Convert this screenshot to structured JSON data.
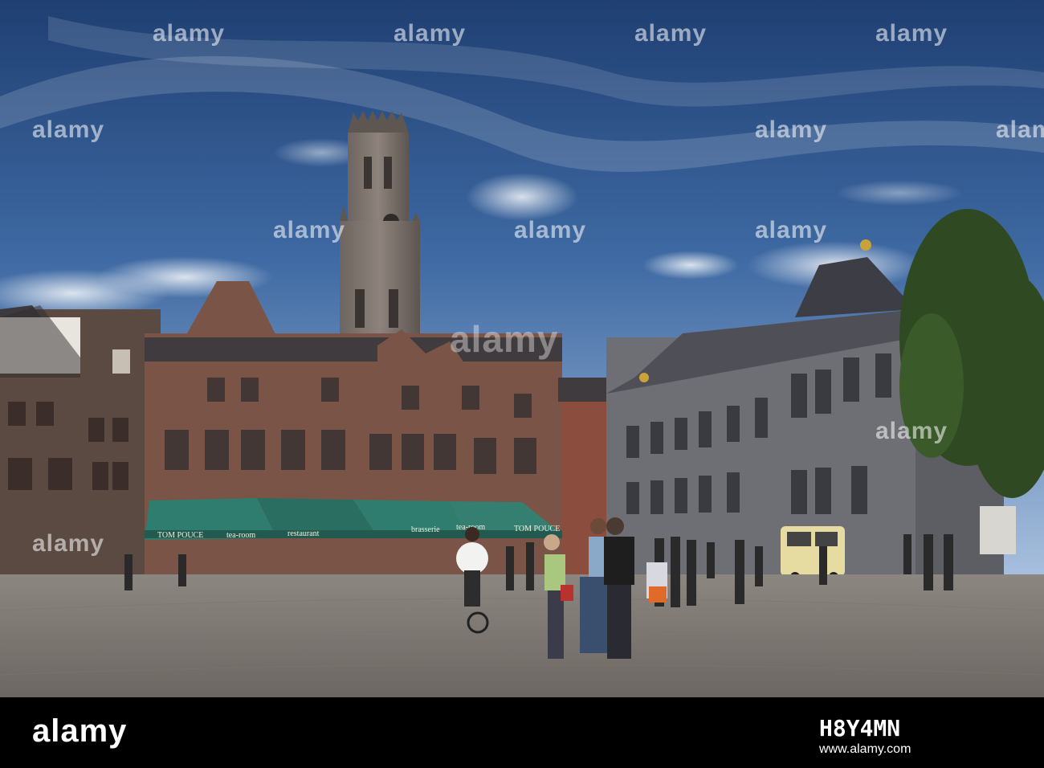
{
  "watermark": {
    "brand": "alamy",
    "repeats": [
      "alamy",
      "alamy",
      "alamy",
      "alamy",
      "alamy",
      "alamy",
      "alamy",
      "alamy",
      "alamy",
      "alamy",
      "alamy",
      "alamy"
    ]
  },
  "footer": {
    "logo": "alamy",
    "image_id": "H8Y4MN",
    "url": "www.alamy.com"
  },
  "signs": {
    "awning_1": "TOM POUCE",
    "awning_2": "tea-room",
    "awning_3": "restaurant",
    "awning_4": "brasserie",
    "awning_5": "tea-room",
    "awning_6": "TOM POUCE"
  },
  "colors": {
    "sky_top": "#2a4f86",
    "sky_bottom": "#8fb0d6",
    "brick": "#7a5446",
    "awning": "#2f7d6f",
    "stone": "#6e6f74",
    "cobbles": "#8a8682"
  }
}
